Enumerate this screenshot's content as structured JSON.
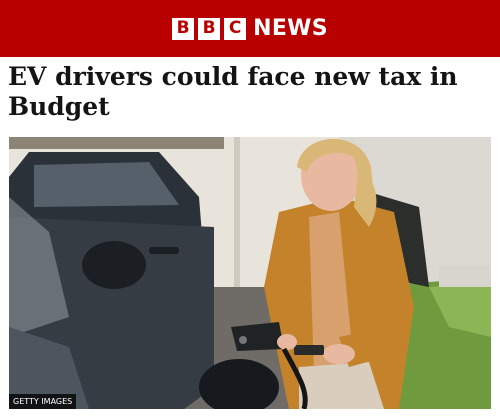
{
  "header": {
    "brand_letters": [
      "B",
      "B",
      "C"
    ],
    "brand_word": "NEWS",
    "brand_color": "#b80000"
  },
  "article": {
    "headline": "EV drivers could face new tax in Budget",
    "image_credit": "GETTY IMAGES"
  }
}
